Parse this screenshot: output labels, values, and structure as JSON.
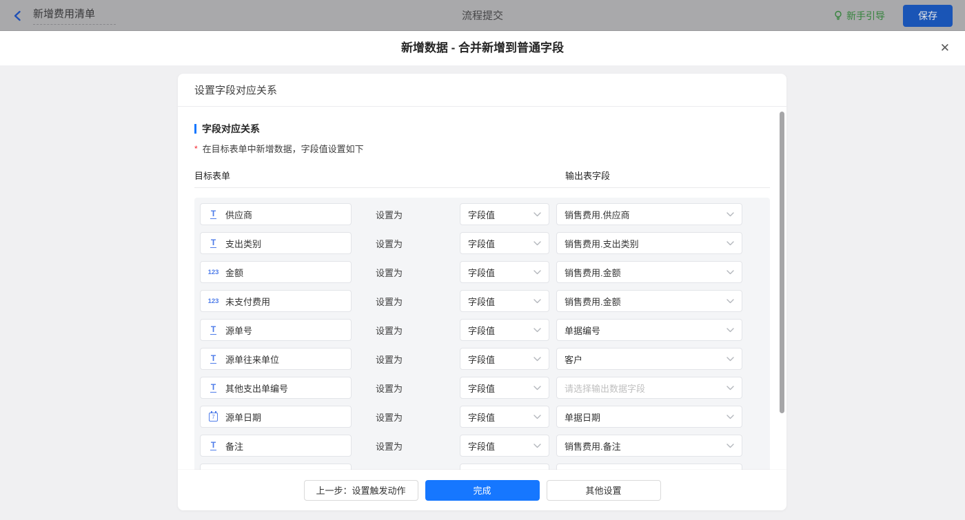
{
  "topbar": {
    "flow_name": "新增费用清单",
    "center_title": "流程提交",
    "guide_label": "新手引导",
    "save_label": "保存"
  },
  "modal": {
    "title": "新增数据 - 合并新增到普通字段",
    "close_glyph": "✕"
  },
  "panel": {
    "title": "设置字段对应关系",
    "section_title": "字段对应关系",
    "required_mark": "*",
    "hint": "在目标表单中新增数据，字段值设置如下",
    "col_left": "目标表单",
    "col_right": "输出表字段",
    "set_as_label": "设置为",
    "rows": [
      {
        "icon": "text",
        "field": "供应商",
        "method": "字段值",
        "output": "销售费用.供应商",
        "output_placeholder": false
      },
      {
        "icon": "text",
        "field": "支出类别",
        "method": "字段值",
        "output": "销售费用.支出类别",
        "output_placeholder": false
      },
      {
        "icon": "number",
        "field": "金额",
        "method": "字段值",
        "output": "销售费用.金额",
        "output_placeholder": false
      },
      {
        "icon": "number",
        "field": "未支付费用",
        "method": "字段值",
        "output": "销售费用.金额",
        "output_placeholder": false
      },
      {
        "icon": "text",
        "field": "源单号",
        "method": "字段值",
        "output": "单据编号",
        "output_placeholder": false
      },
      {
        "icon": "text",
        "field": "源单往来单位",
        "method": "字段值",
        "output": "客户",
        "output_placeholder": false
      },
      {
        "icon": "text",
        "field": "其他支出单编号",
        "method": "字段值",
        "output": "请选择输出数据字段",
        "output_placeholder": true
      },
      {
        "icon": "date",
        "field": "源单日期",
        "method": "字段值",
        "output": "单据日期",
        "output_placeholder": false
      },
      {
        "icon": "text",
        "field": "备注",
        "method": "字段值",
        "output": "销售费用.备注",
        "output_placeholder": false
      },
      {
        "icon": "",
        "field": "",
        "method": "",
        "output": "",
        "output_placeholder": false,
        "partial": true
      }
    ],
    "footer": {
      "prev_label": "上一步：设置触发动作",
      "done_label": "完成",
      "other_label": "其他设置"
    }
  },
  "colors": {
    "accent_blue": "#1677ff",
    "guide_green": "#35833c",
    "required_red": "#f5222d",
    "topbar_dimmed_bg": "#a9a9ab"
  }
}
